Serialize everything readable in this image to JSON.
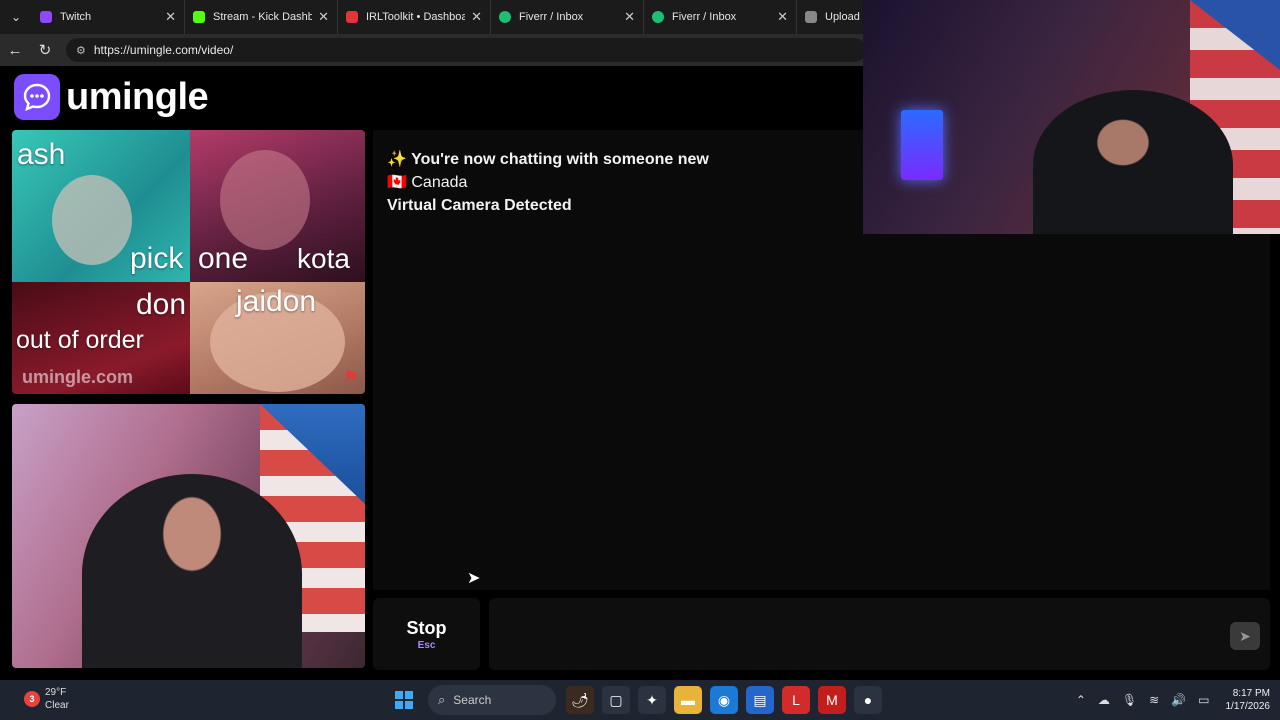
{
  "browser": {
    "tabs": [
      {
        "label": "Twitch",
        "color": "#9146ff"
      },
      {
        "label": "Stream - Kick Dashboard",
        "color": "#53fc18"
      },
      {
        "label": "IRLToolkit • Dashboard",
        "color": "#e5323b"
      },
      {
        "label": "Fiverr / Inbox",
        "color": "#1dbf73"
      },
      {
        "label": "Fiverr / Inbox",
        "color": "#1dbf73"
      },
      {
        "label": "Upload d",
        "color": "#888888"
      }
    ],
    "url": "https://umingle.com/video/"
  },
  "site": {
    "logo_text": "umingle",
    "brand_color": "#7c4dff"
  },
  "stranger_video": {
    "overlay_texts": [
      "ash",
      "pick",
      "one",
      "kota",
      "don",
      "jaidon",
      "out of order"
    ],
    "watermark": "umingle.com"
  },
  "chat": {
    "messages": [
      {
        "icon": "✨",
        "text": "You're now chatting with someone new"
      },
      {
        "icon": "🇨🇦",
        "text": "Canada"
      },
      {
        "icon": "",
        "text": "Virtual Camera Detected"
      }
    ],
    "stop_label": "Stop",
    "stop_shortcut": "Esc",
    "input_placeholder": ""
  },
  "taskbar": {
    "weather_temp": "29°F",
    "weather_desc": "Clear",
    "weather_badge": "3",
    "search_label": "Search",
    "time": "8:17 PM",
    "date": "1/17/2026"
  }
}
